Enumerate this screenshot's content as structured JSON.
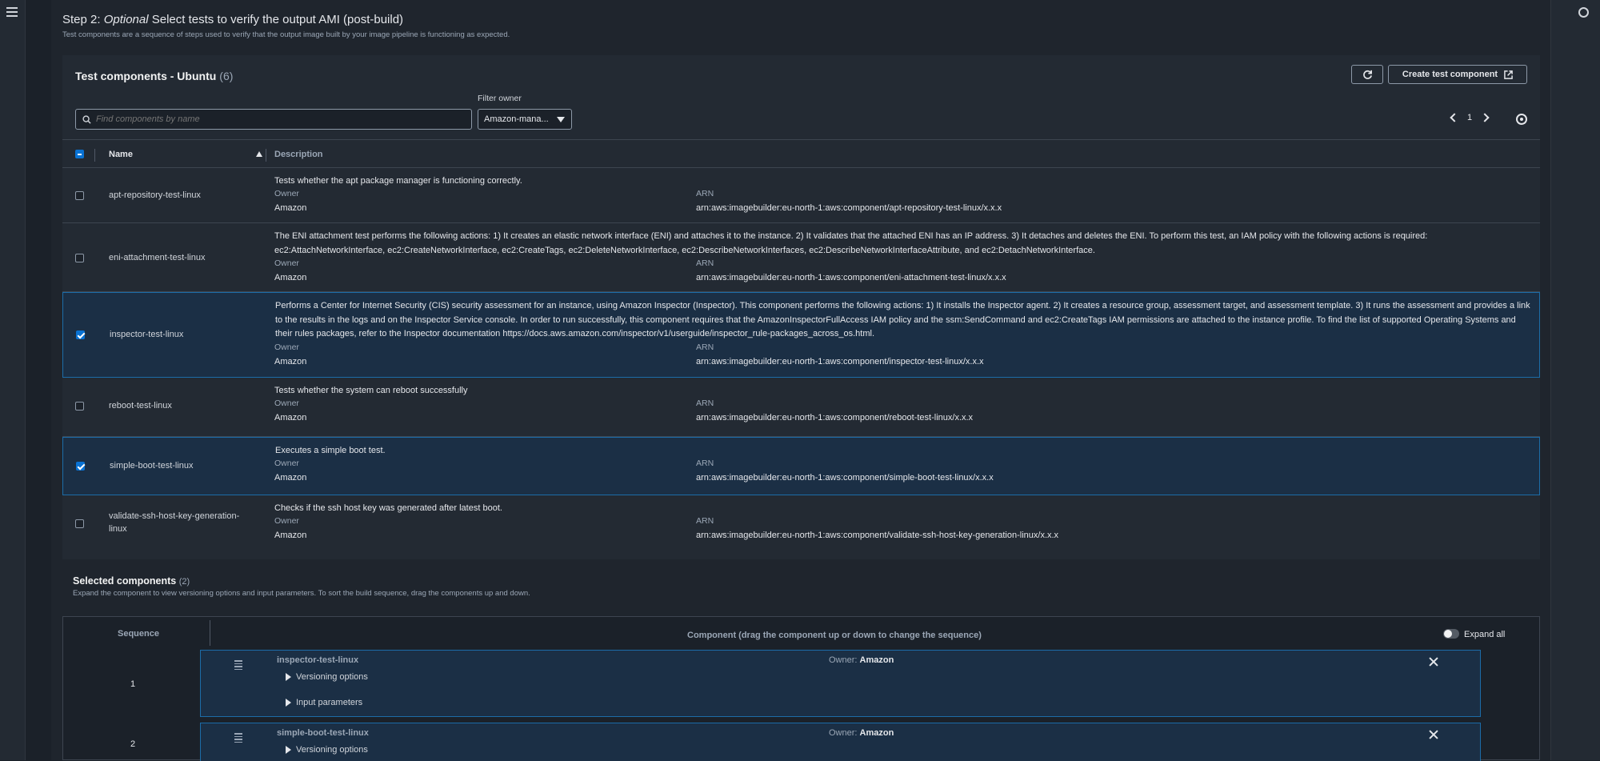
{
  "step": {
    "prefix": "Step 2: ",
    "optional": "Optional",
    "title_rest": " Select tests to verify the output AMI (post-build)",
    "description": "Test components are a sequence of steps used to verify that the output image built by your image pipeline is functioning as expected."
  },
  "panel": {
    "title": "Test components - Ubuntu",
    "count": "(6)",
    "create_button": "Create test component",
    "search_placeholder": "Find components by name",
    "filter_label": "Filter owner",
    "filter_value": "Amazon-mana...",
    "page": "1"
  },
  "table": {
    "col_name": "Name",
    "col_description": "Description",
    "owner_label": "Owner",
    "arn_label": "ARN",
    "rows": [
      {
        "name": "apt-repository-test-linux",
        "checked": false,
        "description": "Tests whether the apt package manager is functioning correctly.",
        "owner": "Amazon",
        "arn": "arn:aws:imagebuilder:eu-north-1:aws:component/apt-repository-test-linux/x.x.x"
      },
      {
        "name": "eni-attachment-test-linux",
        "checked": false,
        "description": "The ENI attachment test performs the following actions: 1) It creates an elastic network interface (ENI) and attaches it to the instance. 2) It validates that the attached ENI has an IP address. 3) It detaches and deletes the ENI. To perform this test, an IAM policy with the following actions is required: ec2:AttachNetworkInterface, ec2:CreateNetworkInterface, ec2:CreateTags, ec2:DeleteNetworkInterface, ec2:DescribeNetworkInterfaces, ec2:DescribeNetworkInterfaceAttribute, and ec2:DetachNetworkInterface.",
        "owner": "Amazon",
        "arn": "arn:aws:imagebuilder:eu-north-1:aws:component/eni-attachment-test-linux/x.x.x"
      },
      {
        "name": "inspector-test-linux",
        "checked": true,
        "description": "Performs a Center for Internet Security (CIS) security assessment for an instance, using Amazon Inspector (Inspector). This component performs the following actions: 1) It installs the Inspector agent. 2) It creates a resource group, assessment target, and assessment template. 3) It runs the assessment and provides a link to the results in the logs and on the Inspector Service console. In order to run successfully, this component requires that the AmazonInspectorFullAccess IAM policy and the ssm:SendCommand and ec2:CreateTags IAM permissions are attached to the instance profile. To find the list of supported Operating Systems and their rules packages, refer to the Inspector documentation https://docs.aws.amazon.com/inspector/v1/userguide/inspector_rule-packages_across_os.html.",
        "owner": "Amazon",
        "arn": "arn:aws:imagebuilder:eu-north-1:aws:component/inspector-test-linux/x.x.x"
      },
      {
        "name": "reboot-test-linux",
        "checked": false,
        "description": "Tests whether the system can reboot successfully",
        "owner": "Amazon",
        "arn": "arn:aws:imagebuilder:eu-north-1:aws:component/reboot-test-linux/x.x.x"
      },
      {
        "name": "simple-boot-test-linux",
        "checked": true,
        "description": "Executes a simple boot test.",
        "owner": "Amazon",
        "arn": "arn:aws:imagebuilder:eu-north-1:aws:component/simple-boot-test-linux/x.x.x"
      },
      {
        "name": "validate-ssh-host-key-generation-linux",
        "checked": false,
        "description": "Checks if the ssh host key was generated after latest boot.",
        "owner": "Amazon",
        "arn": "arn:aws:imagebuilder:eu-north-1:aws:component/validate-ssh-host-key-generation-linux/x.x.x"
      }
    ]
  },
  "selected": {
    "title": "Selected components",
    "count": "(2)",
    "description": "Expand the component to view versioning options and input parameters. To sort the build sequence, drag the components up and down.",
    "sequence_header": "Sequence",
    "component_header": "Component (drag the component up or down to change the sequence)",
    "expand_all": "Expand all",
    "owner_prefix": "Owner: ",
    "versioning": "Versioning options",
    "input_params": "Input parameters",
    "items": [
      {
        "seq": "1",
        "name": "inspector-test-linux",
        "owner": "Amazon"
      },
      {
        "seq": "2",
        "name": "simple-boot-test-linux",
        "owner": "Amazon"
      }
    ]
  }
}
